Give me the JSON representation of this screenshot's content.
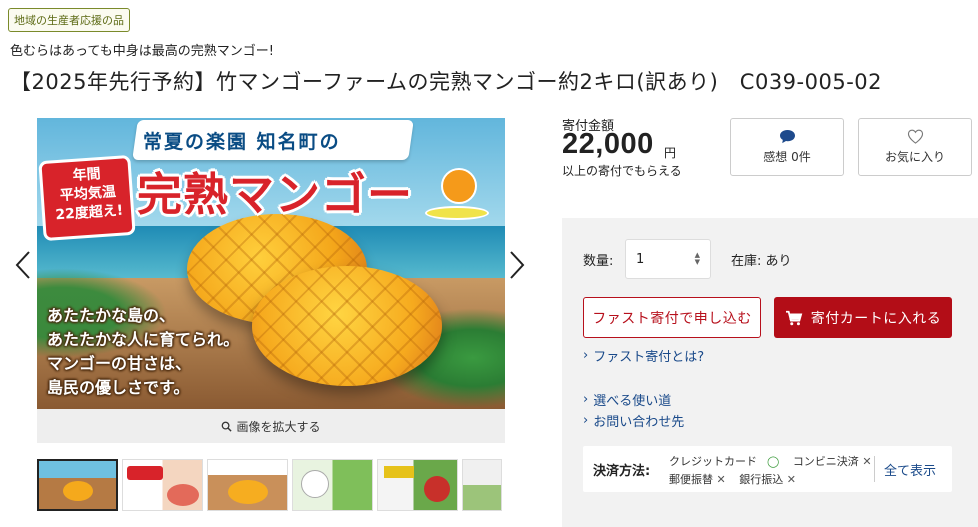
{
  "badge": "地域の生産者応援の品",
  "catch_copy": "色むらはあっても中身は最高の完熟マンゴー!",
  "product_title": "【2025年先行予約】竹マンゴーファームの完熟マンゴー約2キロ(訳あり)　C039-005-02",
  "hero": {
    "banner": "常夏の楽園 知名町の",
    "redtag": [
      "年間",
      "平均気温",
      "22度超え!"
    ],
    "main": "完熟マンゴー",
    "copy": [
      "あたたかな島の、",
      "あたたかな人に育てられ。",
      "マンゴーの甘さは、",
      "島民の優しさです。"
    ]
  },
  "zoom_label": "画像を拡大する",
  "price": {
    "label": "寄付金額",
    "amount": "22,000",
    "unit": "円",
    "note": "以上の寄付でもらえる"
  },
  "actions": {
    "thanks_label": "感想 0件",
    "favorite_label": "お気に入り"
  },
  "order": {
    "qty_label": "数量:",
    "qty_value": "1",
    "stock_label": "在庫: あり",
    "fast_button": "ファスト寄付で申し込む",
    "cart_button": "寄付カートに入れる"
  },
  "links": {
    "fast_about": "ファスト寄付とは?",
    "usage": "選べる使い道",
    "contact": "お問い合わせ先"
  },
  "payment": {
    "label": "決済方法:",
    "credit": "クレジットカード",
    "credit_mark": "◯",
    "conveni": "コンビニ決済",
    "conveni_mark": "✕",
    "postal": "郵便振替",
    "postal_mark": "✕",
    "bank": "銀行振込",
    "bank_mark": "✕",
    "show_all": "全て表示"
  },
  "colors": {
    "accent": "#b30d17",
    "link": "#1a4a8a",
    "badge_border": "#7a8a2a"
  },
  "icons": {
    "thanks": "speech-bubble-icon",
    "favorite": "heart-icon",
    "cart": "cart-icon",
    "zoom": "magnifier-icon"
  }
}
